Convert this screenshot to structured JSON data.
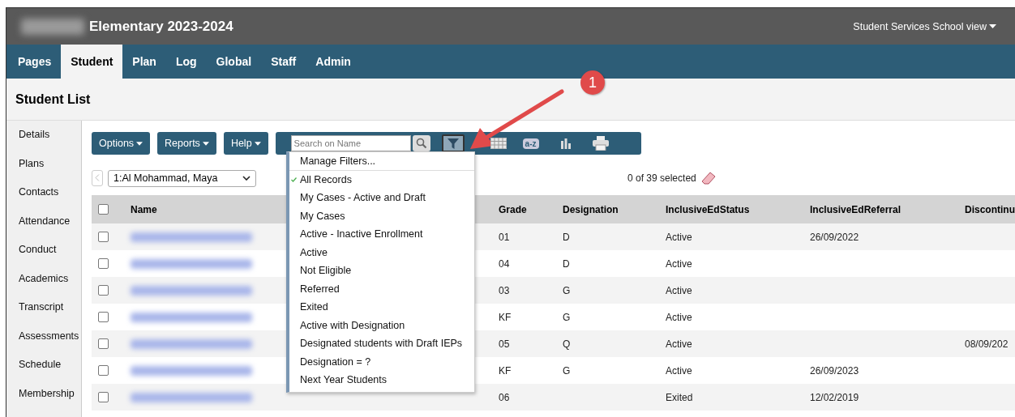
{
  "header": {
    "title": "Elementary 2023-2024",
    "view_menu": "Student Services School view"
  },
  "nav": {
    "tabs": [
      {
        "label": "Pages",
        "selected": false
      },
      {
        "label": "Student",
        "selected": true
      },
      {
        "label": "Plan",
        "selected": false
      },
      {
        "label": "Log",
        "selected": false
      },
      {
        "label": "Global",
        "selected": false
      },
      {
        "label": "Staff",
        "selected": false
      },
      {
        "label": "Admin",
        "selected": false
      }
    ]
  },
  "page_title": "Student List",
  "sidebar": {
    "items": [
      "Details",
      "Plans",
      "Contacts",
      "Attendance",
      "Conduct",
      "Academics",
      "Transcript",
      "Assessments",
      "Schedule",
      "Membership"
    ]
  },
  "toolbar": {
    "buttons": [
      "Options",
      "Reports",
      "Help"
    ],
    "search": {
      "placeholder": "Search on Name"
    },
    "filter_active": true,
    "sort_label": "a-z"
  },
  "record_nav": {
    "value": "1:Al Mohammad, Maya",
    "selection_count": "0 of 39 selected"
  },
  "table": {
    "select_all_checked": false,
    "columns": [
      "Name",
      "Grade",
      "Designation",
      "InclusiveEdStatus",
      "InclusiveEdReferral",
      "Discontinu"
    ],
    "rows": [
      {
        "checked": false,
        "grade": "01",
        "designation": "D",
        "status": "Active",
        "referral": "26/09/2022",
        "discontinued": ""
      },
      {
        "checked": false,
        "grade": "04",
        "designation": "D",
        "status": "Active",
        "referral": "",
        "discontinued": ""
      },
      {
        "checked": false,
        "grade": "03",
        "designation": "G",
        "status": "Active",
        "referral": "",
        "discontinued": ""
      },
      {
        "checked": false,
        "grade": "KF",
        "designation": "G",
        "status": "Active",
        "referral": "",
        "discontinued": ""
      },
      {
        "checked": false,
        "grade": "05",
        "designation": "Q",
        "status": "Active",
        "referral": "",
        "discontinued": "08/09/202"
      },
      {
        "checked": false,
        "grade": "KF",
        "designation": "G",
        "status": "Active",
        "referral": "26/09/2023",
        "discontinued": ""
      },
      {
        "checked": false,
        "grade": "06",
        "designation": "",
        "status": "Exited",
        "referral": "12/02/2019",
        "discontinued": ""
      }
    ]
  },
  "filter_menu": {
    "manage": "Manage Filters...",
    "items": [
      {
        "label": "All Records",
        "selected": true
      },
      {
        "label": "My Cases - Active and Draft",
        "selected": false
      },
      {
        "label": "My Cases",
        "selected": false
      },
      {
        "label": "Active - Inactive Enrollment",
        "selected": false
      },
      {
        "label": "Active",
        "selected": false
      },
      {
        "label": "Not Eligible",
        "selected": false
      },
      {
        "label": "Referred",
        "selected": false
      },
      {
        "label": "Exited",
        "selected": false
      },
      {
        "label": "Active with Designation",
        "selected": false
      },
      {
        "label": "Designated students with Draft IEPs",
        "selected": false
      },
      {
        "label": "Designation = ?",
        "selected": false
      },
      {
        "label": "Next Year Students",
        "selected": false
      }
    ]
  },
  "annotation": {
    "badge": "1"
  }
}
